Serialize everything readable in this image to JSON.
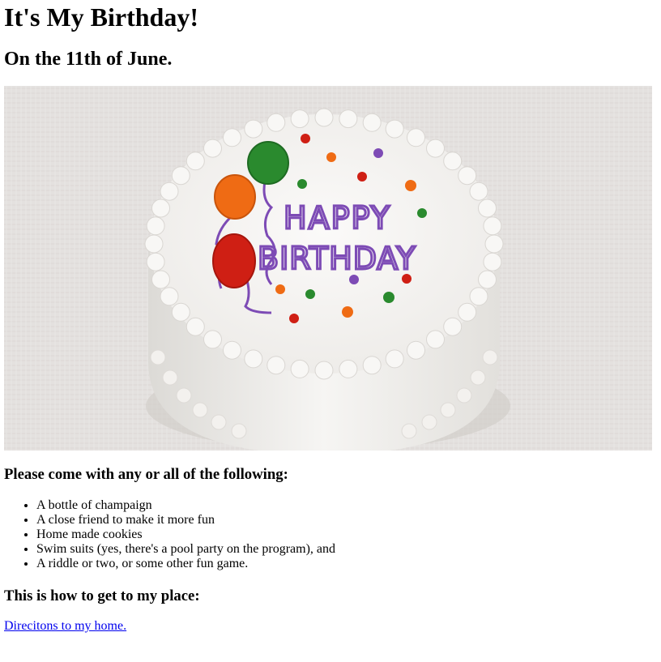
{
  "page": {
    "title": "It's My Birthday!",
    "date_heading": "On the 11th of June."
  },
  "photo": {
    "cake_text_line1": "HAPPY",
    "cake_text_line2": "BIRTHDAY",
    "colors": {
      "background": "#e4e1df",
      "frosting": "#f7f6f4",
      "letters": "#7d4bb5",
      "balloon_green": "#2a8a2e",
      "balloon_orange": "#ef6b14",
      "balloon_red": "#cf1f14"
    }
  },
  "items_section": {
    "heading": "Please come with any or all of the following:",
    "items": [
      "A bottle of champaign",
      "A close friend to make it more fun",
      "Home made cookies",
      "Swim suits (yes, there's a pool party on the program), and",
      "A riddle or two, or some other fun game."
    ]
  },
  "directions": {
    "heading": "This is how to get to my place:",
    "link_text": "Direcitons to my home."
  }
}
